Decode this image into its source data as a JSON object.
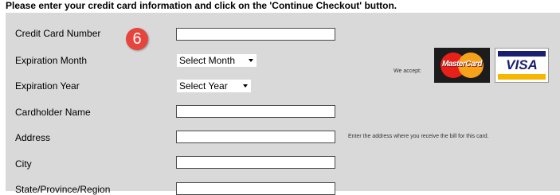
{
  "instruction": "Please enter your credit card information and click on the 'Continue Checkout' button.",
  "step_badge": "6",
  "form": {
    "card_number": {
      "label": "Credit Card Number",
      "value": ""
    },
    "exp_month": {
      "label": "Expiration Month",
      "selected": "Select Month"
    },
    "exp_year": {
      "label": "Expiration Year",
      "selected": "Select Year"
    },
    "cardholder_name": {
      "label": "Cardholder Name",
      "value": ""
    },
    "address": {
      "label": "Address",
      "value": "",
      "hint": "Enter the address where you receive the bill for this card."
    },
    "city": {
      "label": "City",
      "value": ""
    },
    "state": {
      "label": "State/Province/Region",
      "value": ""
    }
  },
  "payment": {
    "accept_label": "We accept:",
    "cards": [
      "MasterCard",
      "VISA"
    ]
  },
  "colors": {
    "panel": "#d9d9d9",
    "badge": "#e5453c",
    "visa_blue": "#1a1f71",
    "visa_gold": "#f7b600"
  }
}
